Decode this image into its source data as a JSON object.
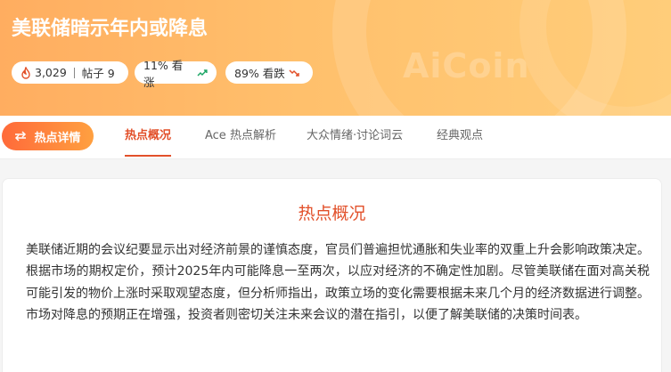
{
  "header": {
    "title": "美联储暗示年内或降息",
    "watermark": "AiCoin",
    "stats": {
      "hot_count": "3,029",
      "posts_label": "帖子 9"
    },
    "bullish": "11% 看涨",
    "bearish": "89% 看跌"
  },
  "tabs": {
    "hot_button": "热点详情",
    "items": [
      "热点概况",
      "Ace 热点解析",
      "大众情绪·讨论词云",
      "经典观点"
    ],
    "active": "热点概况"
  },
  "content": {
    "section_title": "热点概况",
    "body": "美联储近期的会议纪要显示出对经济前景的谨慎态度，官员们普遍担忧通胀和失业率的双重上升会影响政策决定。根据市场的期权定价，预计2025年内可能降息一至两次，以应对经济的不确定性加剧。尽管美联储在面对高关税可能引发的物价上涨时采取观望态度，但分析师指出，政策立场的变化需要根据未来几个月的经济数据进行调整。市场对降息的预期正在增强，投资者则密切关注未来会议的潜在指引，以便了解美联储的决策时间表。"
  },
  "colors": {
    "accent": "#e2502a",
    "hero_start": "#ffad60",
    "hero_end": "#ffcd7a",
    "up": "#1aa564",
    "down": "#e2502a"
  }
}
